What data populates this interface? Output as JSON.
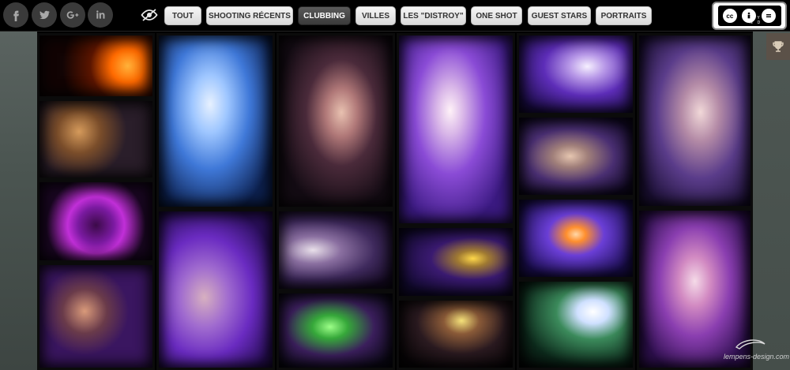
{
  "social": [
    {
      "name": "facebook-icon",
      "glyph": "f"
    },
    {
      "name": "twitter-icon",
      "glyph": "t"
    },
    {
      "name": "google-plus-icon",
      "glyph": "g+"
    },
    {
      "name": "linkedin-icon",
      "glyph": "in"
    }
  ],
  "filters": {
    "tout": "TOUT",
    "shooting_recents": "SHOOTING RÉCENTS",
    "clubbing": "CLUBBING",
    "villes": "VILLES",
    "les_distroy": "LES \"DISTROY\"",
    "one_shot": "ONE SHOT",
    "guest_stars": "GUEST STARS",
    "portraits": "PORTRAITS"
  },
  "active_filter": "CLUBBING",
  "license": {
    "cc": "cc",
    "by": "BY",
    "nd": "ND"
  },
  "watermark": "lempens-design.com",
  "colors": {
    "active_button": "#3a3a3a",
    "button": "#e6e6e6",
    "topbar": "#000000"
  },
  "icons": {
    "eye": "eye-icon",
    "trophy": "trophy-icon"
  }
}
